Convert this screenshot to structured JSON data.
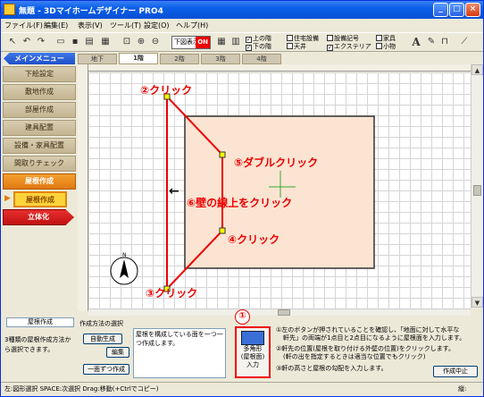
{
  "title_bar": {
    "title": "無題 - 3Dマイホームデザイナー PRO4",
    "minimize": "_",
    "maximize": "□",
    "close": "×"
  },
  "menu": [
    "ファイル(F)",
    "編集(E)",
    "表示(V)",
    "ツール(T)",
    "設定(O)",
    "ヘルプ(H)"
  ],
  "toolbar": {
    "overlay_label": "下図表示",
    "overlay_state": "ON",
    "checks": [
      {
        "label": "上の階",
        "checked": true
      },
      {
        "label": "下の階",
        "checked": true
      },
      {
        "label": "住宅設備",
        "checked": false
      },
      {
        "label": "天井",
        "checked": false
      },
      {
        "label": "設備記号",
        "checked": false
      },
      {
        "label": "エクステリア",
        "checked": true
      },
      {
        "label": "家具",
        "checked": false
      },
      {
        "label": "小物",
        "checked": false
      }
    ],
    "text_tool": "A"
  },
  "sidebar": {
    "main_menu": "メインメニュー",
    "items": [
      "下絵設定",
      "敷地作成",
      "部屋作成",
      "建具配置",
      "設備・家具配置",
      "間取りチェック",
      "屋根作成",
      "屋根作成",
      "立体化"
    ]
  },
  "tabs": [
    "地下",
    "1階",
    "2階",
    "3階",
    "4階"
  ],
  "annotations": {
    "click2": "②クリック",
    "dblclick5": "⑤ダブルクリック",
    "wall6": "⑥壁の線上をクリック",
    "click4": "④クリック",
    "click3": "③クリック",
    "arrow": "←",
    "num1": "①"
  },
  "colors": {
    "annotation": "#e00000",
    "outline": "#e00000",
    "room_fill": "#fce4d2",
    "accent_blue": "#1d4fc8",
    "orange": "#f08a1a"
  },
  "bottom": {
    "left_title": "屋根作成",
    "left_text": "3種類の屋根作成方法から選択できます。",
    "method_label": "作成方法の選択",
    "auto_button": "自動生成",
    "edit_button": "編集",
    "one_by_one": "一面ずつ作成",
    "description": "屋根を構成している面を一つ一つ作成します。",
    "polygon_button_lines": [
      "多角形",
      "(屋根面)",
      "入力"
    ],
    "instructions": [
      "①左のボタンが押されていることを確認し、「地面に対して水平な",
      "軒先」の両端が1点目と2点目になるように屋根面を入力します。",
      "②軒先の位置(屋根を取り付ける外壁の位置)をクリックします。",
      "(軒の出を指定するときは適当な位置でもクリック)",
      "③軒の高さと屋根の勾配を入力します。"
    ],
    "cancel_button": "作成中止"
  },
  "status_bar": {
    "text": "左:図形選択 SPACE:次選択 Drag:移動(+Ctrlでコピー)",
    "right": "縦:"
  }
}
